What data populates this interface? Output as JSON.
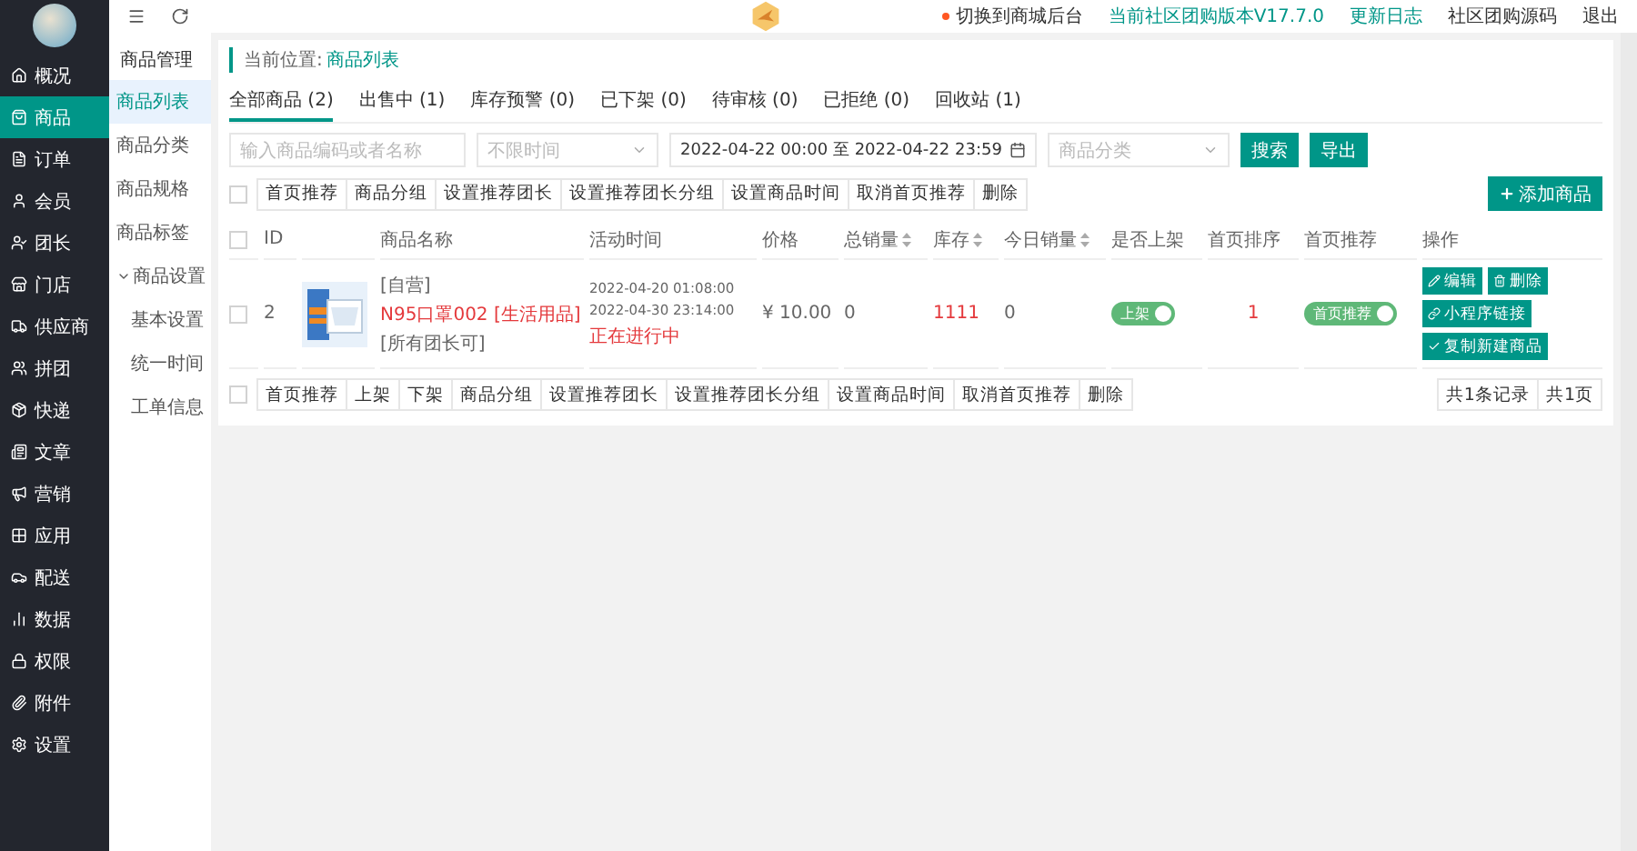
{
  "topbar": {
    "status_link": "切换到商城后台",
    "links": [
      {
        "label": "当前社区团购版本V17.7.0",
        "kind": "accent"
      },
      {
        "label": "更新日志",
        "kind": "accent"
      },
      {
        "label": "社区团购源码",
        "kind": "plain"
      },
      {
        "label": "退出",
        "kind": "plain"
      }
    ]
  },
  "sidebar": {
    "items": [
      {
        "label": "概况",
        "selected": false
      },
      {
        "label": "商品",
        "selected": true
      },
      {
        "label": "订单",
        "selected": false
      },
      {
        "label": "会员",
        "selected": false
      },
      {
        "label": "团长",
        "selected": false
      },
      {
        "label": "门店",
        "selected": false
      },
      {
        "label": "供应商",
        "selected": false
      },
      {
        "label": "拼团",
        "selected": false
      },
      {
        "label": "快递",
        "selected": false
      },
      {
        "label": "文章",
        "selected": false
      },
      {
        "label": "营销",
        "selected": false
      },
      {
        "label": "应用",
        "selected": false
      },
      {
        "label": "配送",
        "selected": false
      },
      {
        "label": "数据",
        "selected": false
      },
      {
        "label": "权限",
        "selected": false
      },
      {
        "label": "附件",
        "selected": false
      },
      {
        "label": "设置",
        "selected": false
      }
    ]
  },
  "subnav": {
    "title": "商品管理",
    "items": [
      {
        "label": "商品列表",
        "selected": true
      },
      {
        "label": "商品分类",
        "selected": false
      },
      {
        "label": "商品规格",
        "selected": false
      },
      {
        "label": "商品标签",
        "selected": false
      },
      {
        "label": "商品设置",
        "selected": false,
        "expanded": true,
        "children": [
          {
            "label": "基本设置",
            "selected": false
          },
          {
            "label": "统一时间",
            "selected": false
          },
          {
            "label": "工单信息",
            "selected": false
          }
        ]
      }
    ]
  },
  "breadcrumb": {
    "label": "当前位置:",
    "current": "商品列表"
  },
  "tabs": [
    {
      "label": "全部商品 (2)",
      "selected": true
    },
    {
      "label": "出售中 (1)",
      "selected": false
    },
    {
      "label": "库存预警 (0)",
      "selected": false
    },
    {
      "label": "已下架 (0)",
      "selected": false
    },
    {
      "label": "待审核 (0)",
      "selected": false
    },
    {
      "label": "已拒绝 (0)",
      "selected": false
    },
    {
      "label": "回收站 (1)",
      "selected": false
    }
  ],
  "filters": {
    "keyword_placeholder": "输入商品编码或者名称",
    "time_select": "不限时间",
    "date_range": "2022-04-22 00:00 至 2022-04-22 23:59",
    "category_placeholder": "商品分类",
    "buttons": [
      "搜索",
      "导出"
    ]
  },
  "bulk_actions_top": {
    "all_checked": false,
    "buttons": [
      "首页推荐",
      "商品分组",
      "设置推荐团长",
      "设置推荐团长分组",
      "设置商品时间",
      "取消首页推荐",
      "删除"
    ]
  },
  "add_button": "添加商品",
  "table": {
    "header_checked": false,
    "columns": [
      {
        "label": "ID",
        "sortable": false
      },
      {
        "label": "商品名称",
        "sortable": false
      },
      {
        "label": "活动时间",
        "sortable": false
      },
      {
        "label": "价格",
        "sortable": false
      },
      {
        "label": "总销量",
        "sortable": true
      },
      {
        "label": "库存",
        "sortable": true
      },
      {
        "label": "今日销量",
        "sortable": true
      },
      {
        "label": "是否上架",
        "sortable": false
      },
      {
        "label": "首页排序",
        "sortable": false
      },
      {
        "label": "首页推荐",
        "sortable": false
      },
      {
        "label": "操作",
        "sortable": false
      }
    ],
    "rows": [
      {
        "checked": false,
        "id": "2",
        "tag": "[自营]",
        "name": "N95口罩002 [生活用品]",
        "scope": "[所有团长可]",
        "start": "2022-04-20 01:08:00",
        "end": "2022-04-30 23:14:00",
        "status": "正在进行中",
        "price": "¥ 10.00",
        "total_sales": "0",
        "stock": "1111",
        "today_sales": "0",
        "listed": {
          "label": "上架",
          "on": true
        },
        "sort": "1",
        "recommend": {
          "label": "首页推荐",
          "on": true
        },
        "actions": [
          {
            "label": "编辑",
            "kind": "edit"
          },
          {
            "label": "删除",
            "kind": "delete"
          },
          {
            "label": "小程序链接",
            "kind": "link"
          },
          {
            "label": "复制新建商品",
            "kind": "copy"
          }
        ]
      }
    ]
  },
  "bulk_actions_bottom": {
    "all_checked": false,
    "buttons": [
      "首页推荐",
      "上架",
      "下架",
      "商品分组",
      "设置推荐团长",
      "设置推荐团长分组",
      "设置商品时间",
      "取消首页推荐",
      "删除"
    ]
  },
  "pagination": [
    "共1条记录",
    "共1页"
  ]
}
